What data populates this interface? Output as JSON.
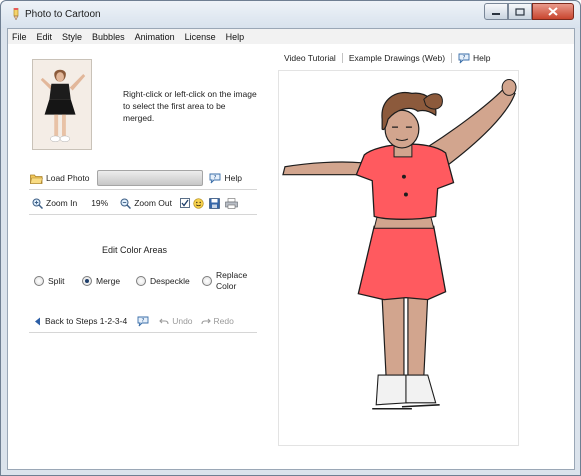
{
  "window": {
    "title": "Photo to Cartoon"
  },
  "menu": [
    "File",
    "Edit",
    "Style",
    "Bubbles",
    "Animation",
    "License",
    "Help"
  ],
  "instruction": "Right-click or left-click on the image to select the first area to be merged.",
  "load_bar": {
    "load_label": "Load Photo",
    "help_label": "Help"
  },
  "zoom_bar": {
    "zoom_in_label": "Zoom In",
    "zoom_value": "19%",
    "zoom_out_label": "Zoom Out"
  },
  "edit_section": {
    "title": "Edit Color Areas"
  },
  "modes": [
    {
      "label": "Split",
      "selected": false
    },
    {
      "label": "Merge",
      "selected": true
    },
    {
      "label": "Despeckle",
      "selected": false
    },
    {
      "label": "Replace Color",
      "selected": false
    }
  ],
  "nav_bar": {
    "back_label": "Back to Steps 1-2-3-4",
    "undo_label": "Undo",
    "redo_label": "Redo"
  },
  "links": {
    "video": "Video Tutorial",
    "examples": "Example Drawings (Web)",
    "help": "Help"
  },
  "colors": {
    "outfit": "#ff5a5f",
    "skin": "#d2a58e",
    "hair": "#8c5a3c",
    "window_frame": "#dbe3ec"
  },
  "icons": [
    "app-icon",
    "folder-icon",
    "help-icon",
    "zoom-in-icon",
    "zoom-out-icon",
    "checkbox-icon",
    "face-icon",
    "save-icon",
    "print-icon",
    "back-arrow-icon",
    "undo-icon",
    "redo-icon",
    "minimize-icon",
    "maximize-icon",
    "close-icon"
  ]
}
